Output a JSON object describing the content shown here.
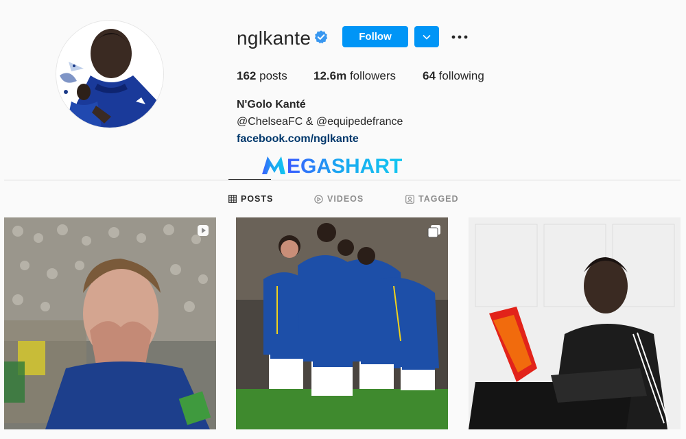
{
  "profile": {
    "username": "nglkante",
    "follow_label": "Follow",
    "stats": {
      "posts_count": "162",
      "posts_label": "posts",
      "followers_count": "12.6m",
      "followers_label": "followers",
      "following_count": "64",
      "following_label": "following"
    },
    "full_name": "N'Golo Kanté",
    "bio": "@ChelseaFC & @equipedefrance",
    "link": "facebook.com/nglkante"
  },
  "watermark": "MEGASHART",
  "tabs": [
    {
      "label": "POSTS",
      "icon": "grid-icon",
      "active": true
    },
    {
      "label": "VIDEOS",
      "icon": "play-circle-icon",
      "active": false
    },
    {
      "label": "TAGGED",
      "icon": "tag-user-icon",
      "active": false
    }
  ],
  "colors": {
    "accent": "#0095f6",
    "link": "#00376b",
    "verified": "#3897f0",
    "chelsea_blue": "#1d4fa8",
    "pitch_green": "#3f8a2e"
  }
}
